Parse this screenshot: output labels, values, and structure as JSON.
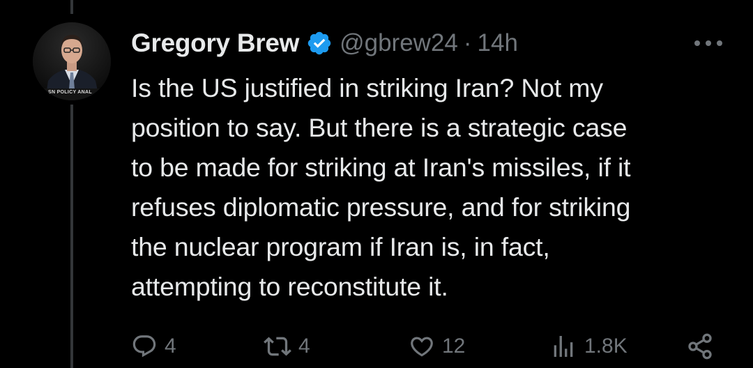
{
  "tweet": {
    "author": {
      "display_name": "Gregory Brew",
      "handle": "@gbrew24",
      "verified": true,
      "avatar_caption": "SN POLICY ANAL"
    },
    "separator": "·",
    "time": "14h",
    "text_lines": [
      "Is the US justified in striking Iran? Not my",
      "position to say. But there is a strategic case",
      "to be made for striking at Iran's missiles, if it",
      "refuses diplomatic pressure, and for striking",
      "the nuclear program if Iran is, in fact,",
      "attempting to reconstitute it."
    ],
    "actions": {
      "replies": "4",
      "reposts": "4",
      "likes": "12",
      "views": "1.8K"
    }
  },
  "icons": {
    "verified": "verified-badge-icon",
    "more": "more-horizontal-icon",
    "reply": "reply-bubble-icon",
    "repost": "repost-arrows-icon",
    "like": "heart-icon",
    "views": "bar-chart-icon",
    "share": "share-nodes-icon"
  },
  "colors": {
    "background": "#000000",
    "text": "#e7e9ea",
    "secondary": "#71767b",
    "verified": "#1d9bf0"
  }
}
